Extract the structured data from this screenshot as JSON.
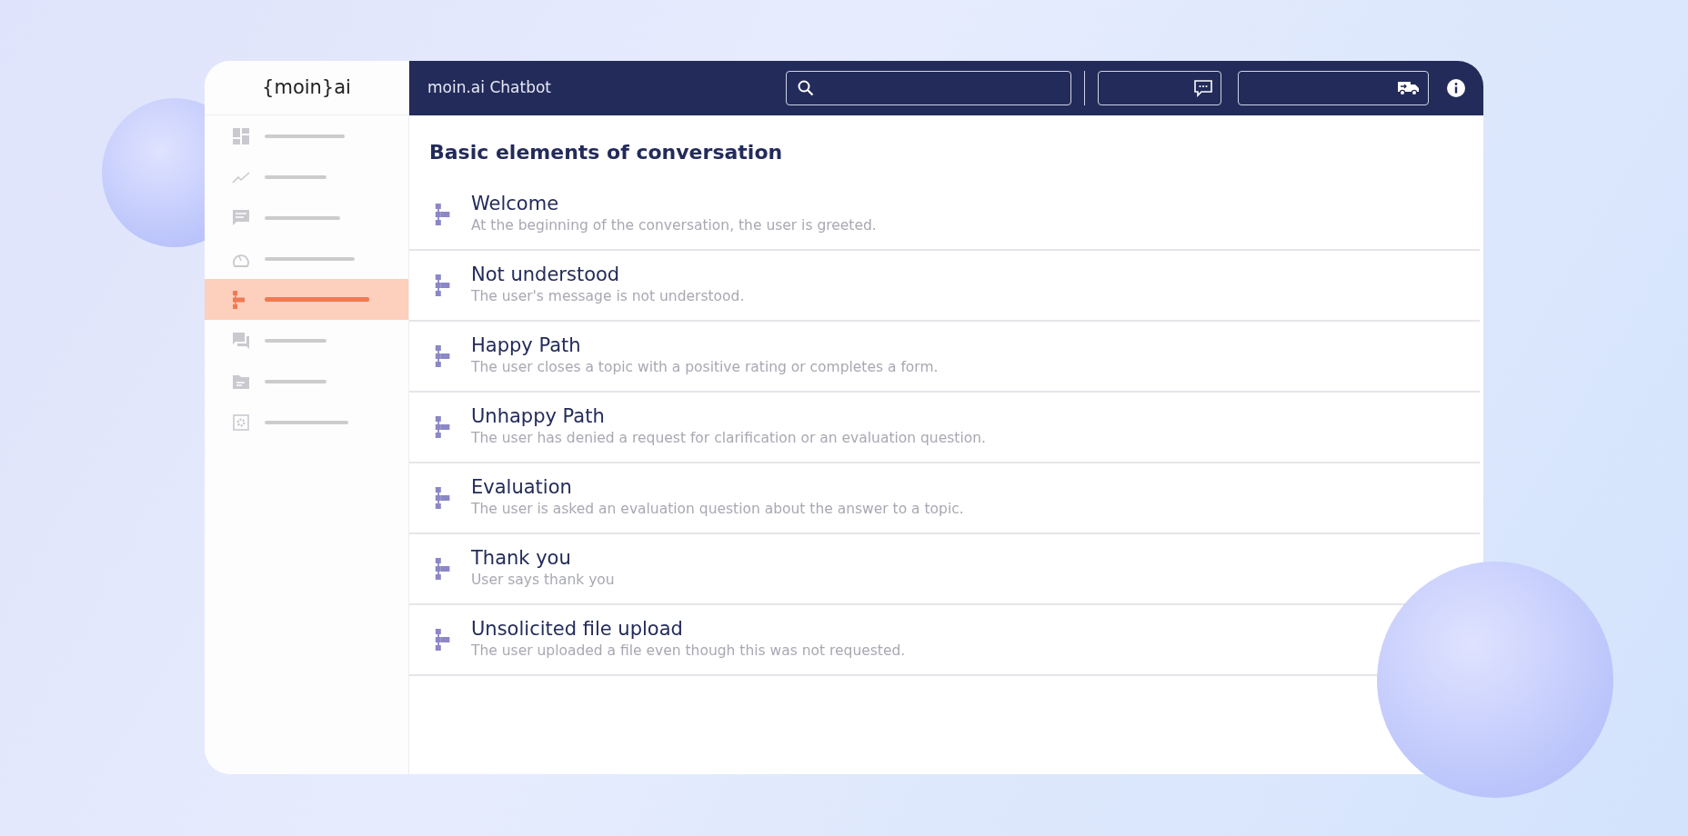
{
  "logo": "{moin}ai",
  "sidebar": {
    "items": [
      {
        "kind": "dashboard",
        "selected": false
      },
      {
        "kind": "chart",
        "selected": false
      },
      {
        "kind": "chat",
        "selected": false
      },
      {
        "kind": "gauge",
        "selected": false
      },
      {
        "kind": "flow",
        "selected": true
      },
      {
        "kind": "forum",
        "selected": false
      },
      {
        "kind": "folder",
        "selected": false
      },
      {
        "kind": "settings",
        "selected": false
      }
    ]
  },
  "topbar": {
    "title": "moin.ai Chatbot"
  },
  "section_title": "Basic elements of conversation",
  "topics": [
    {
      "title": "Welcome",
      "description": "At the beginning of the conversation, the user is greeted."
    },
    {
      "title": "Not understood",
      "description": "The user's message is not understood."
    },
    {
      "title": "Happy Path",
      "description": "The user closes a topic with a positive rating or completes a form."
    },
    {
      "title": "Unhappy Path",
      "description": "The user has denied a request for clarification or an evaluation question."
    },
    {
      "title": "Evaluation",
      "description": "The user is asked an evaluation question about the answer to a topic."
    },
    {
      "title": "Thank you",
      "description": "User says thank you"
    },
    {
      "title": "Unsolicited file upload",
      "description": "The user uploaded a file even though this was not requested."
    }
  ]
}
